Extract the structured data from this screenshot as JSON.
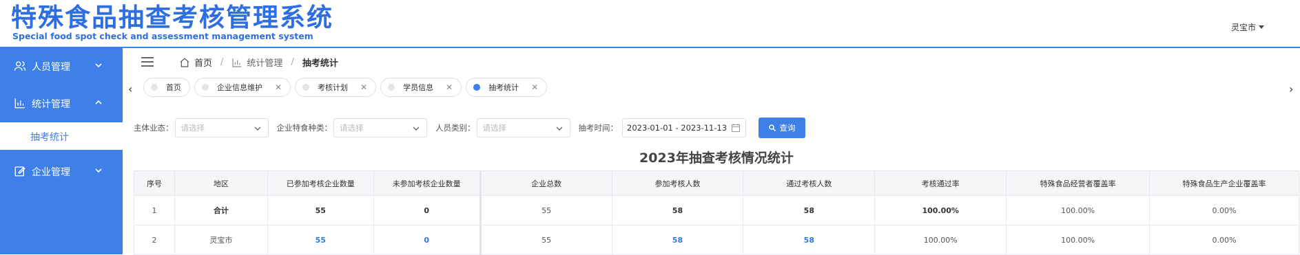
{
  "header": {
    "title": "特殊食品抽查考核管理系统",
    "subtitle": "Special food spot check and assessment management system",
    "city": "灵宝市"
  },
  "sidebar": {
    "items": [
      {
        "label": "人员管理",
        "icon": "users-icon"
      },
      {
        "label": "统计管理",
        "icon": "bar-chart-icon"
      },
      {
        "label": "企业管理",
        "icon": "edit-icon"
      }
    ],
    "active_sub": "抽考统计"
  },
  "breadcrumb": {
    "home": "首页",
    "section": "统计管理",
    "current": "抽考统计",
    "sep": "/"
  },
  "tabs": [
    {
      "label": "首页"
    },
    {
      "label": "企业信息维护"
    },
    {
      "label": "考核计划"
    },
    {
      "label": "学员信息"
    },
    {
      "label": "抽考统计"
    }
  ],
  "filters": {
    "business_label": "主体业态：",
    "business_placeholder": "请选择",
    "food_type_label": "企业特食种类：",
    "food_type_placeholder": "请选择",
    "person_type_label": "人员类别：",
    "person_type_placeholder": "请选择",
    "time_label": "抽考时间：",
    "time_value": "2023-01-01 - 2023-11-13",
    "query_label": "查询"
  },
  "table": {
    "title": "2023年抽查考核情况统计",
    "headers": [
      "序号",
      "地区",
      "已参加考核企业数量",
      "未参加考核企业数量",
      "企业总数",
      "参加考核人数",
      "通过考核人数",
      "考核通过率",
      "特殊食品经营者覆盖率",
      "特殊食品生产企业覆盖率"
    ],
    "rows": [
      [
        "1",
        "合计",
        "55",
        "0",
        "55",
        "58",
        "58",
        "100.00%",
        "100.00%",
        "0.00%"
      ],
      [
        "2",
        "灵宝市",
        "55",
        "0",
        "55",
        "58",
        "58",
        "100.00%",
        "100.00%",
        "0.00%"
      ]
    ]
  },
  "colors": {
    "primary": "#3e7fe8",
    "link": "#2d78e6"
  }
}
